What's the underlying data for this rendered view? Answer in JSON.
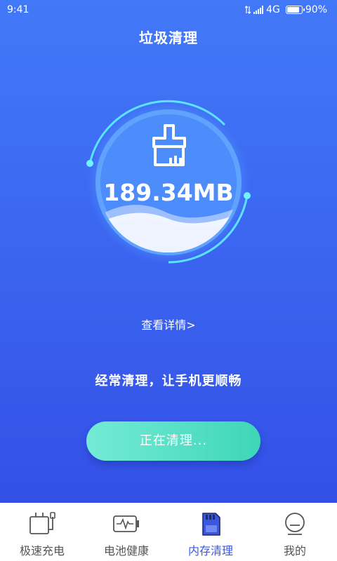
{
  "status_bar": {
    "time": "9:41",
    "network": "4G",
    "battery_percent": "90%",
    "battery_level": 0.9
  },
  "header": {
    "title": "垃圾清理"
  },
  "gauge": {
    "size": "189.34MB",
    "icon": "broom-icon"
  },
  "details_link": "查看详情>",
  "tagline": "经常清理，让手机更顺畅",
  "action_button": "正在清理...",
  "colors": {
    "background_top": "#4279f8",
    "background_bottom": "#3450e6",
    "button_start": "#74ebd5",
    "button_end": "#3ed6b8",
    "active_tab": "#3a57e0"
  },
  "bottom_nav": {
    "items": [
      {
        "label": "极速充电",
        "icon": "charger-icon"
      },
      {
        "label": "电池健康",
        "icon": "battery-health-icon"
      },
      {
        "label": "内存清理",
        "icon": "memory-card-icon",
        "active": true
      },
      {
        "label": "我的",
        "icon": "profile-icon"
      }
    ]
  }
}
